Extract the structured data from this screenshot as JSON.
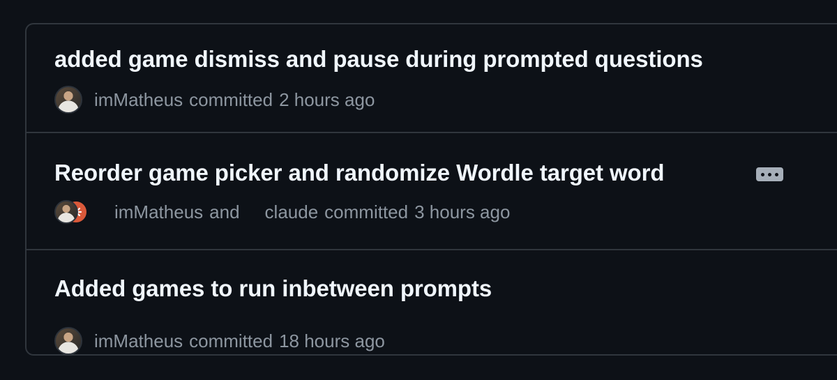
{
  "commits": [
    {
      "title": "added game dismiss and pause during prompted questions",
      "author": "imMatheus",
      "committed": "committed",
      "time": "2 hours ago"
    },
    {
      "title": "Reorder game picker and randomize Wordle target word",
      "author": "imMatheus",
      "and_text": "and",
      "coauthor": "claude",
      "committed": "committed",
      "time": "3 hours ago",
      "has_ellipsis": true
    },
    {
      "title": "Added games to run inbetween prompts",
      "author": "imMatheus",
      "committed": "committed",
      "time": "18 hours ago"
    }
  ],
  "colors": {
    "background": "#0d1117",
    "border": "#30363d",
    "title": "#f0f6fc",
    "muted": "#8d96a0",
    "claude_avatar": "#d9593a"
  },
  "icons": {
    "author_avatar": "avatar-photo",
    "coauthor_avatar": "claude-starburst-icon",
    "expand_message": "ellipsis-icon"
  }
}
